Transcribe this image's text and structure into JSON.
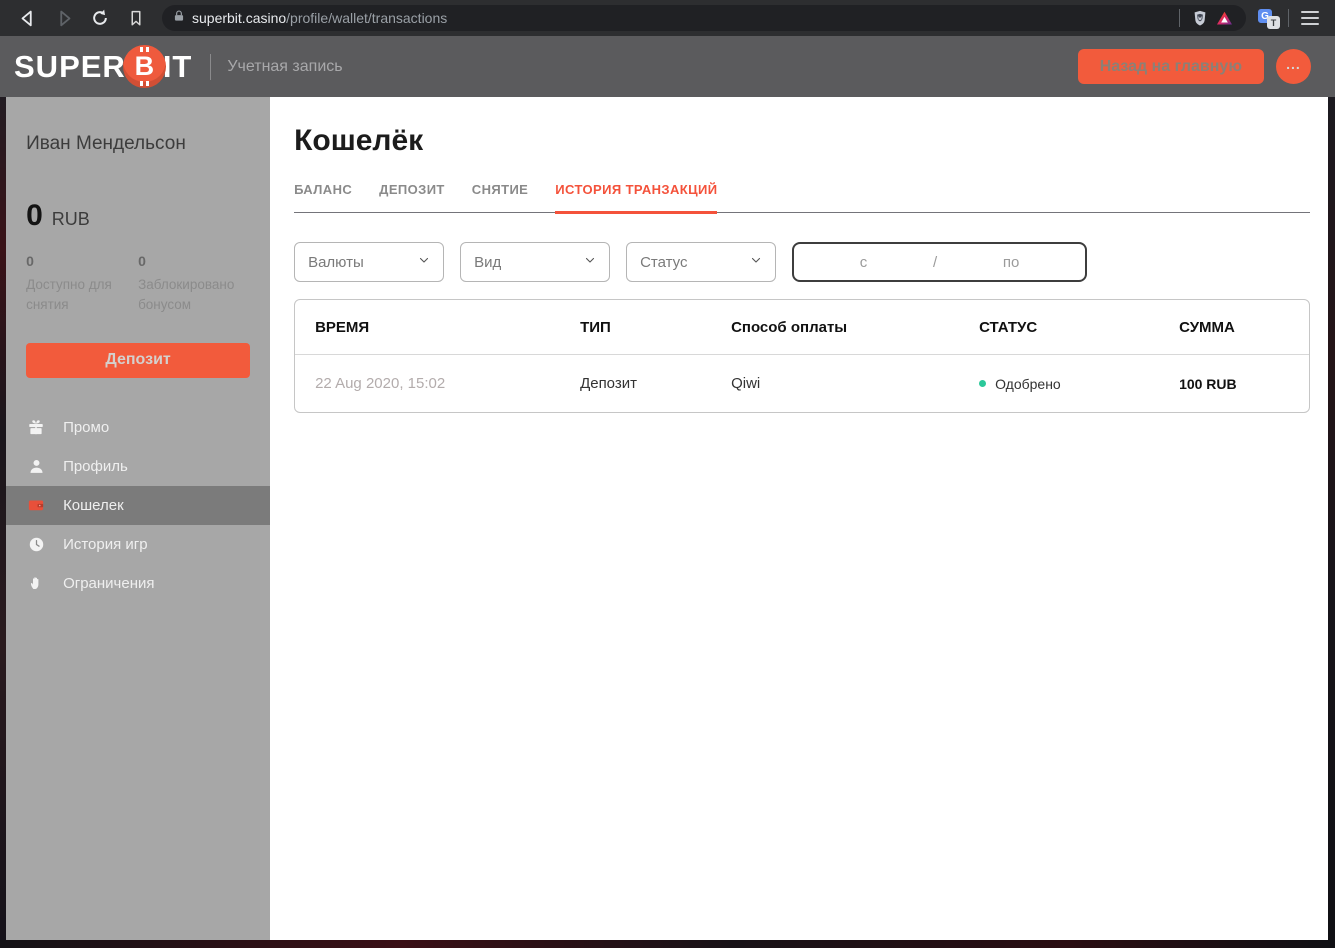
{
  "browser": {
    "url": {
      "domain": "superbit.casino",
      "path": "/profile/wallet/transactions"
    },
    "icons": [
      "back-icon",
      "forward-icon",
      "reload-icon",
      "bookmark-icon",
      "lock-icon",
      "brave-shield-icon",
      "bat-icon",
      "translate-icon",
      "menu-icon"
    ],
    "translate_g": "G",
    "translate_t": "T"
  },
  "header": {
    "logo": {
      "super": "SUPER",
      "coin": "B",
      "it": "IT"
    },
    "section_label": "Учетная запись",
    "back_home_button": "Назад на главную",
    "more_button": "..."
  },
  "sidebar": {
    "user_name": "Иван Мендельсон",
    "balance": {
      "amount": "0",
      "currency": "RUB"
    },
    "stats": [
      {
        "value": "0",
        "label": "Доступно для снятия"
      },
      {
        "value": "0",
        "label": "Заблокировано бонусом"
      }
    ],
    "deposit_button": "Депозит",
    "nav": [
      {
        "label": "Промо",
        "icon": "gift-icon",
        "active": false
      },
      {
        "label": "Профиль",
        "icon": "person-icon",
        "active": false
      },
      {
        "label": "Кошелек",
        "icon": "wallet-icon",
        "active": true
      },
      {
        "label": "История игр",
        "icon": "clock-icon",
        "active": false
      },
      {
        "label": "Ограничения",
        "icon": "hand-icon",
        "active": false
      }
    ]
  },
  "main": {
    "title": "Кошелёк",
    "tabs": [
      {
        "label": "БАЛАНС",
        "active": false
      },
      {
        "label": "ДЕПОЗИТ",
        "active": false
      },
      {
        "label": "СНЯТИЕ",
        "active": false
      },
      {
        "label": "ИСТОРИЯ ТРАНЗАКЦИЙ",
        "active": true
      }
    ],
    "filters": {
      "currency_label": "Валюты",
      "type_label": "Вид",
      "status_label": "Статус",
      "date_from": "с",
      "date_separator": "/",
      "date_to": "по"
    },
    "table": {
      "columns": [
        "ВРЕМЯ",
        "ТИП",
        "Способ оплаты",
        "СТАТУС",
        "СУММА"
      ],
      "rows": [
        {
          "time": "22 Aug 2020, 15:02",
          "type": "Депозит",
          "payment_method": "Qiwi",
          "status": "Одобрено",
          "amount": "100 RUB"
        }
      ]
    }
  },
  "colors": {
    "accent_orange": "#f25b3c",
    "active_tab": "#f4523b",
    "status_green": "#2bc89a",
    "header_gray": "#5b5b5d",
    "sidebar_gray": "#a7a7a7"
  }
}
